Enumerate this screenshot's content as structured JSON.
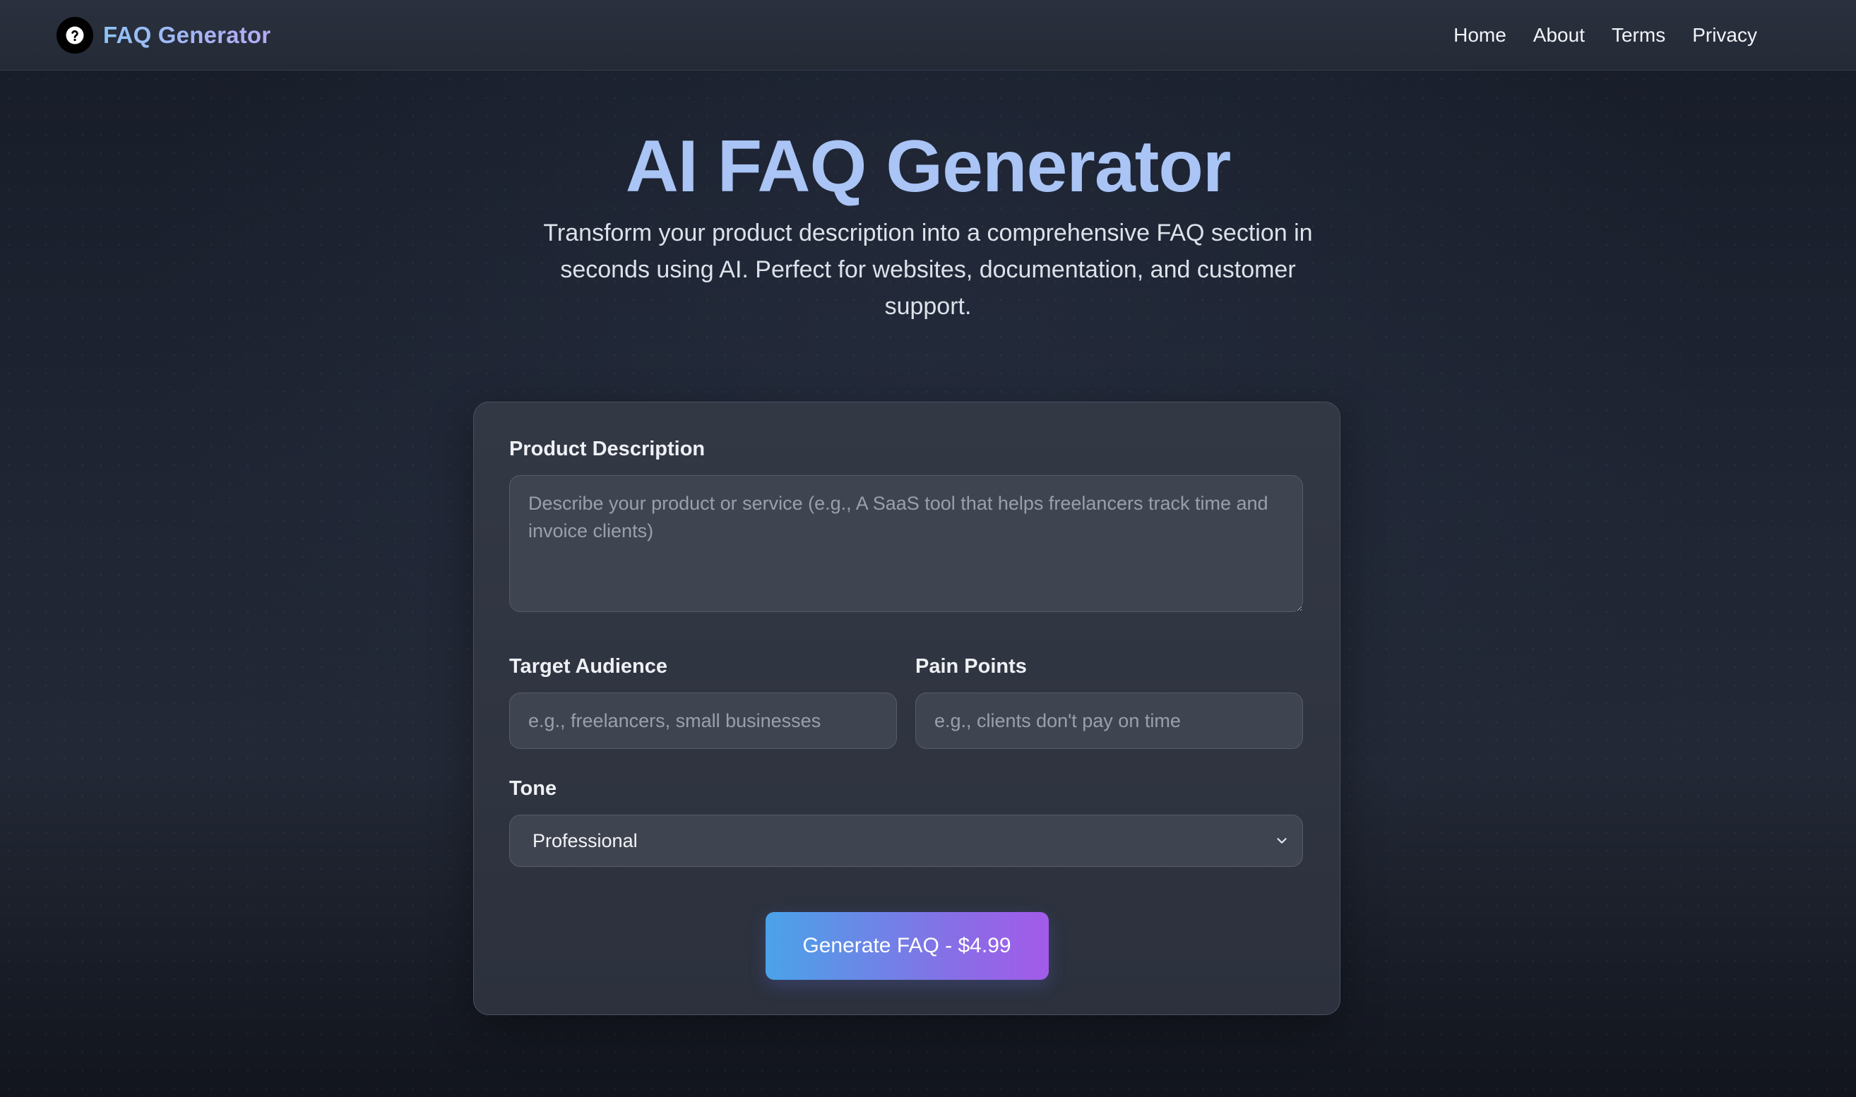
{
  "header": {
    "brand_name": "FAQ Generator",
    "brand_icon": "question-circle-icon",
    "nav": [
      {
        "label": "Home"
      },
      {
        "label": "About"
      },
      {
        "label": "Terms"
      },
      {
        "label": "Privacy"
      }
    ]
  },
  "hero": {
    "title": "AI FAQ Generator",
    "subtitle": "Transform your product description into a comprehensive FAQ section in seconds using AI. Perfect for websites, documentation, and customer support."
  },
  "form": {
    "product_description": {
      "label": "Product Description",
      "placeholder": "Describe your product or service (e.g., A SaaS tool that helps freelancers track time and invoice clients)",
      "value": ""
    },
    "target_audience": {
      "label": "Target Audience",
      "placeholder": "e.g., freelancers, small businesses",
      "value": ""
    },
    "pain_points": {
      "label": "Pain Points",
      "placeholder": "e.g., clients don't pay on time",
      "value": ""
    },
    "tone": {
      "label": "Tone",
      "selected": "Professional"
    },
    "submit_label": "Generate FAQ - $4.99"
  },
  "colors": {
    "accent_gradient_start": "#4aa3e8",
    "accent_gradient_end": "#a35be9",
    "title_color": "#a9c4f5",
    "background": "#1f2533"
  }
}
